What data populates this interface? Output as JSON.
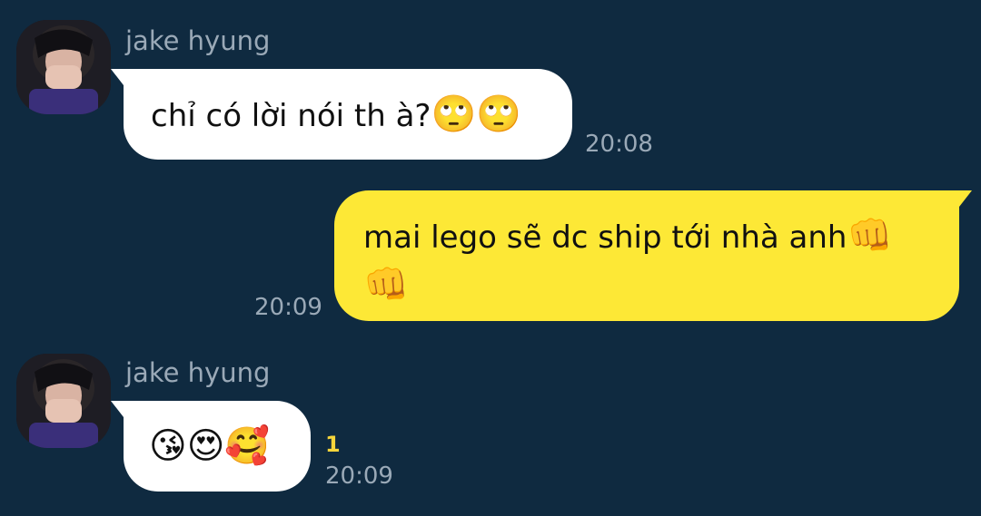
{
  "messages": [
    {
      "sender": "jake hyung",
      "direction": "incoming",
      "text": "chỉ có lời nói th à?",
      "emoji": "🙄🙄",
      "time": "20:08"
    },
    {
      "direction": "outgoing",
      "text": "mai lego sẽ dc ship tới nhà anh",
      "emoji_inline": "👊",
      "emoji_line2": "👊",
      "time": "20:09"
    },
    {
      "sender": "jake hyung",
      "direction": "incoming",
      "emoji": "😘😍🥰",
      "unread_count": "1",
      "time": "20:09"
    }
  ],
  "colors": {
    "background": "#0f2a40",
    "incoming_bubble": "#ffffff",
    "outgoing_bubble": "#fde836",
    "meta_text": "#9aa9b7",
    "unread": "#f6d53b"
  },
  "icons": {
    "avatar": "profile-photo-icon"
  }
}
